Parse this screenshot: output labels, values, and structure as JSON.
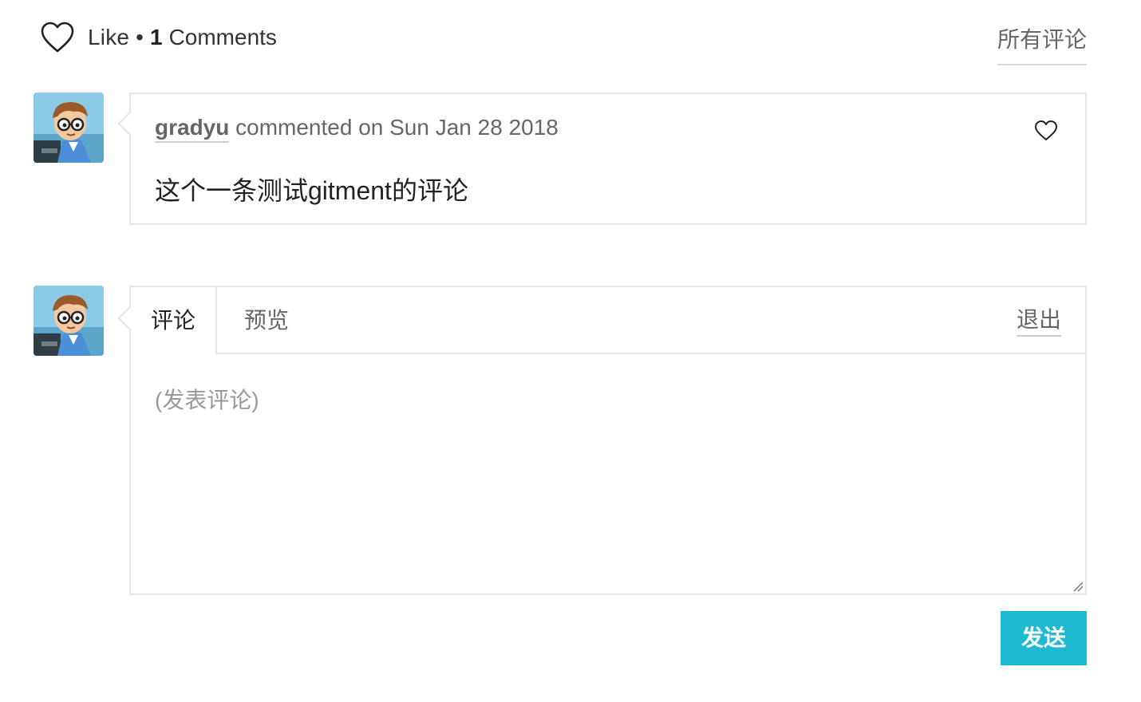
{
  "header": {
    "like_label": "Like",
    "separator": "•",
    "comment_count": "1",
    "comment_count_label": "Comments",
    "all_comments_label": "所有评论",
    "like_icon": "heart-icon"
  },
  "comments": [
    {
      "author": "gradyu",
      "meta": "commented on Sun Jan 28 2018",
      "body": "这个一条测试gitment的评论",
      "like_icon": "heart-icon",
      "avatar": "cartoon-avatar"
    }
  ],
  "editor": {
    "tab_write": "评论",
    "tab_preview": "预览",
    "logout_label": "退出",
    "placeholder": "(发表评论)",
    "value": "",
    "submit_label": "发送",
    "avatar": "cartoon-avatar"
  },
  "colors": {
    "accent": "#1fb9d3",
    "border": "#e3e5e6",
    "muted_text": "#666666"
  }
}
